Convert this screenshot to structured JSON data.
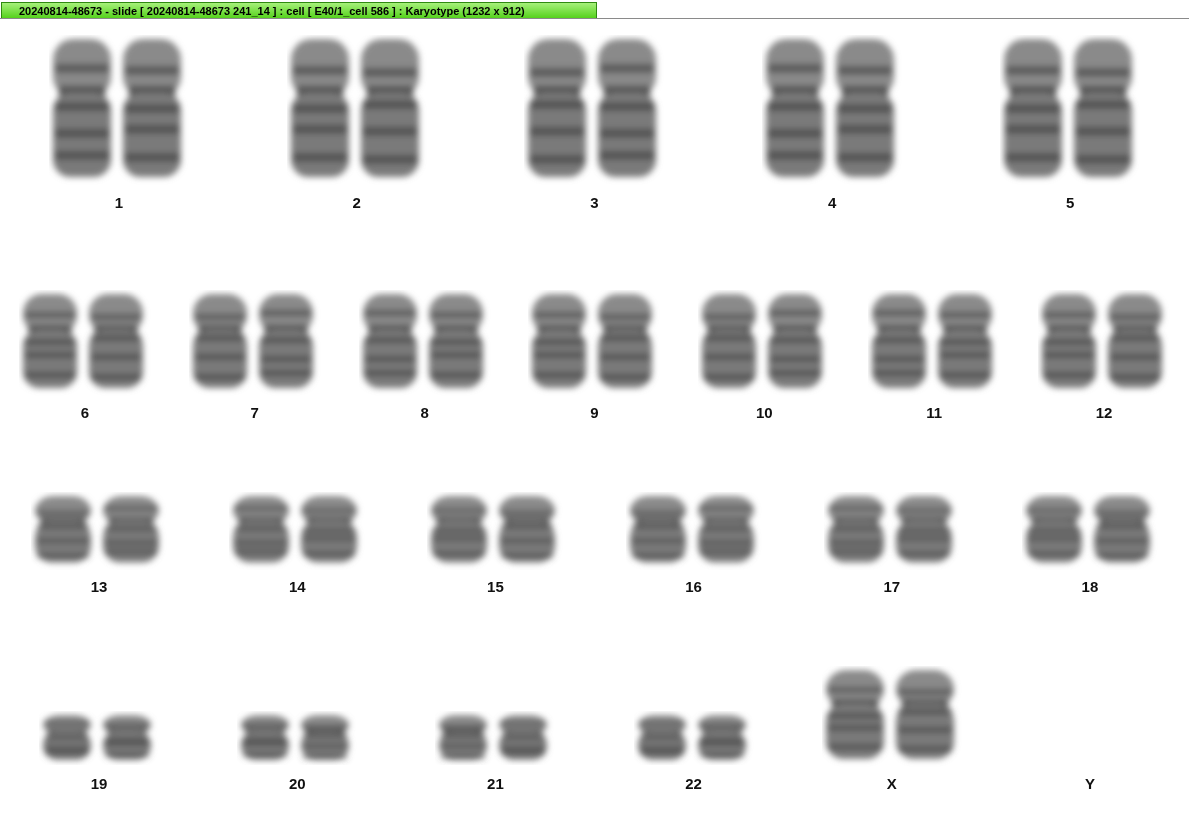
{
  "window": {
    "title": "20240814-48673 - slide [ 20240814-48673 241_14 ] : cell [ E40/1_cell 586 ] : Karyotype  (1232 x 912)"
  },
  "karyotype": {
    "rows": [
      {
        "pairs": [
          {
            "label": "1",
            "kind": "pair"
          },
          {
            "label": "2",
            "kind": "pair"
          },
          {
            "label": "3",
            "kind": "pair"
          },
          {
            "label": "4",
            "kind": "pair"
          },
          {
            "label": "5",
            "kind": "pair"
          }
        ]
      },
      {
        "pairs": [
          {
            "label": "6",
            "kind": "pair"
          },
          {
            "label": "7",
            "kind": "pair"
          },
          {
            "label": "8",
            "kind": "pair"
          },
          {
            "label": "9",
            "kind": "pair"
          },
          {
            "label": "10",
            "kind": "pair"
          },
          {
            "label": "11",
            "kind": "pair"
          },
          {
            "label": "12",
            "kind": "pair"
          }
        ]
      },
      {
        "pairs": [
          {
            "label": "13",
            "kind": "pair"
          },
          {
            "label": "14",
            "kind": "pair"
          },
          {
            "label": "15",
            "kind": "pair"
          },
          {
            "label": "16",
            "kind": "pair"
          },
          {
            "label": "17",
            "kind": "pair"
          },
          {
            "label": "18",
            "kind": "pair"
          }
        ]
      },
      {
        "pairs": [
          {
            "label": "19",
            "kind": "pair"
          },
          {
            "label": "20",
            "kind": "pair"
          },
          {
            "label": "21",
            "kind": "pair"
          },
          {
            "label": "22",
            "kind": "pair"
          },
          {
            "label": "X",
            "kind": "large-pair"
          },
          {
            "label": "Y",
            "kind": "none"
          }
        ]
      }
    ]
  }
}
